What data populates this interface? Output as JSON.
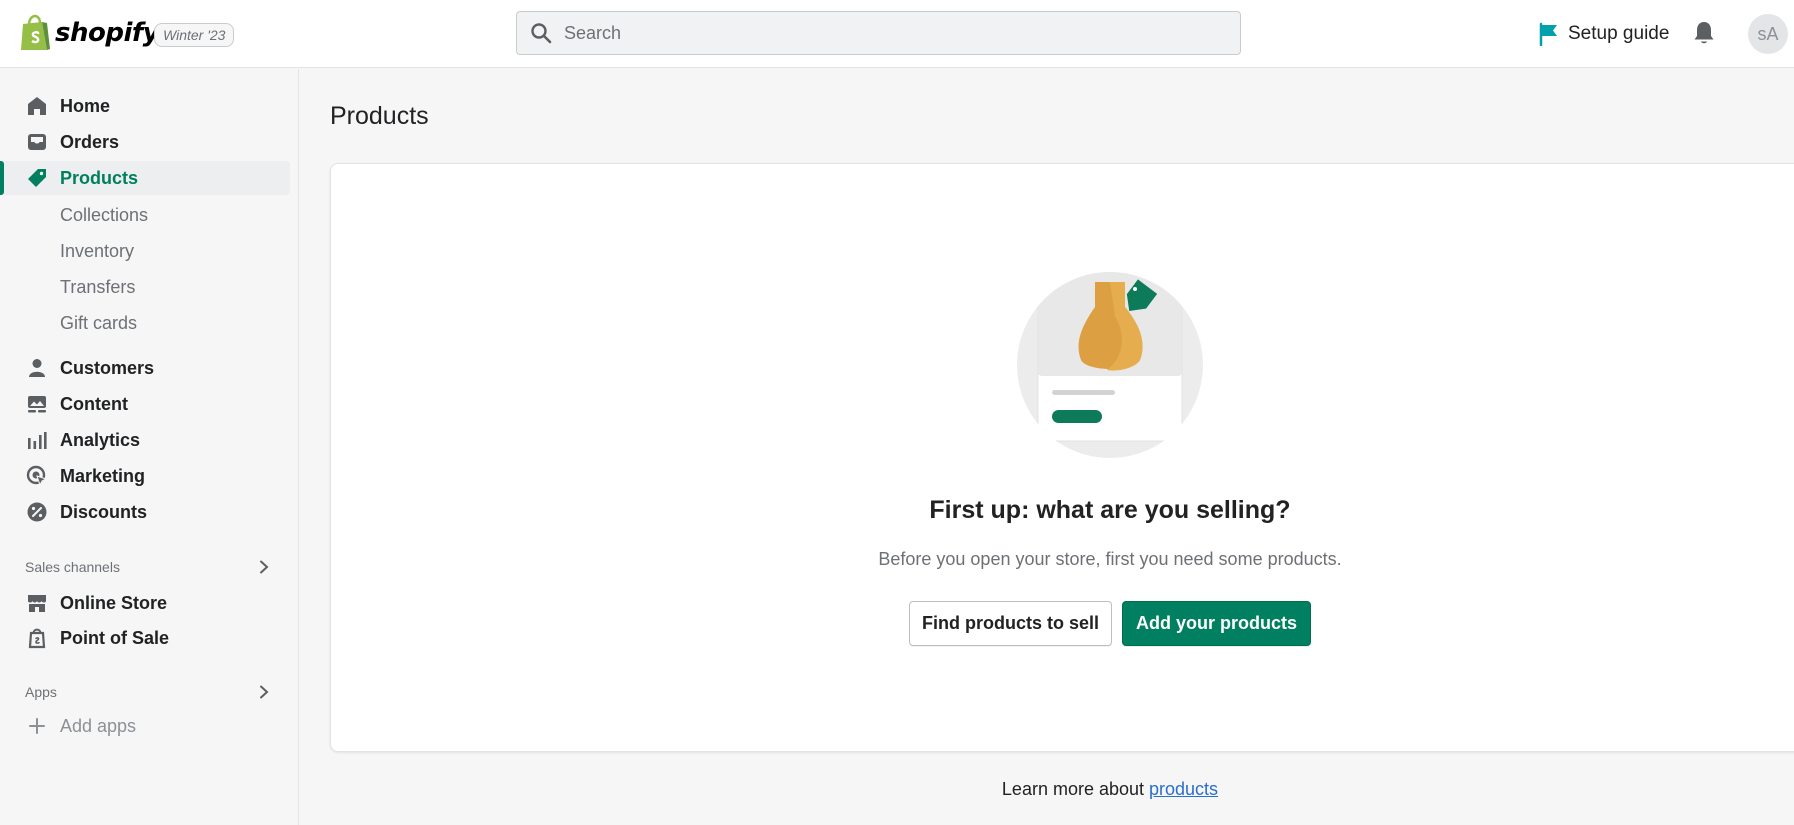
{
  "header": {
    "brand": "shopify",
    "edition": "Winter '23",
    "search_placeholder": "Search",
    "setup_guide": "Setup guide",
    "avatar_initials": "sA"
  },
  "sidebar": {
    "items": [
      {
        "label": "Home",
        "icon": "home-icon"
      },
      {
        "label": "Orders",
        "icon": "inbox-icon"
      },
      {
        "label": "Products",
        "icon": "tag-icon",
        "active": true
      },
      {
        "label": "Customers",
        "icon": "person-icon"
      },
      {
        "label": "Content",
        "icon": "image-icon"
      },
      {
        "label": "Analytics",
        "icon": "bar-chart-icon"
      },
      {
        "label": "Marketing",
        "icon": "target-icon"
      },
      {
        "label": "Discounts",
        "icon": "discount-icon"
      }
    ],
    "product_subitems": [
      "Collections",
      "Inventory",
      "Transfers",
      "Gift cards"
    ],
    "sales_channels_heading": "Sales channels",
    "sales_channels": [
      {
        "label": "Online Store",
        "icon": "store-icon"
      },
      {
        "label": "Point of Sale",
        "icon": "pos-icon"
      }
    ],
    "apps_heading": "Apps",
    "add_apps": "Add apps"
  },
  "main": {
    "title": "Products",
    "empty_heading": "First up: what are you selling?",
    "empty_sub": "Before you open your store, first you need some products.",
    "find_button": "Find products to sell",
    "add_button": "Add your products",
    "learn_prefix": "Learn more about ",
    "learn_link": "products"
  },
  "colors": {
    "accent": "#008060",
    "active_text": "#007f5f",
    "link": "#2c6ecb",
    "setup_flag": "#00a0ac"
  }
}
